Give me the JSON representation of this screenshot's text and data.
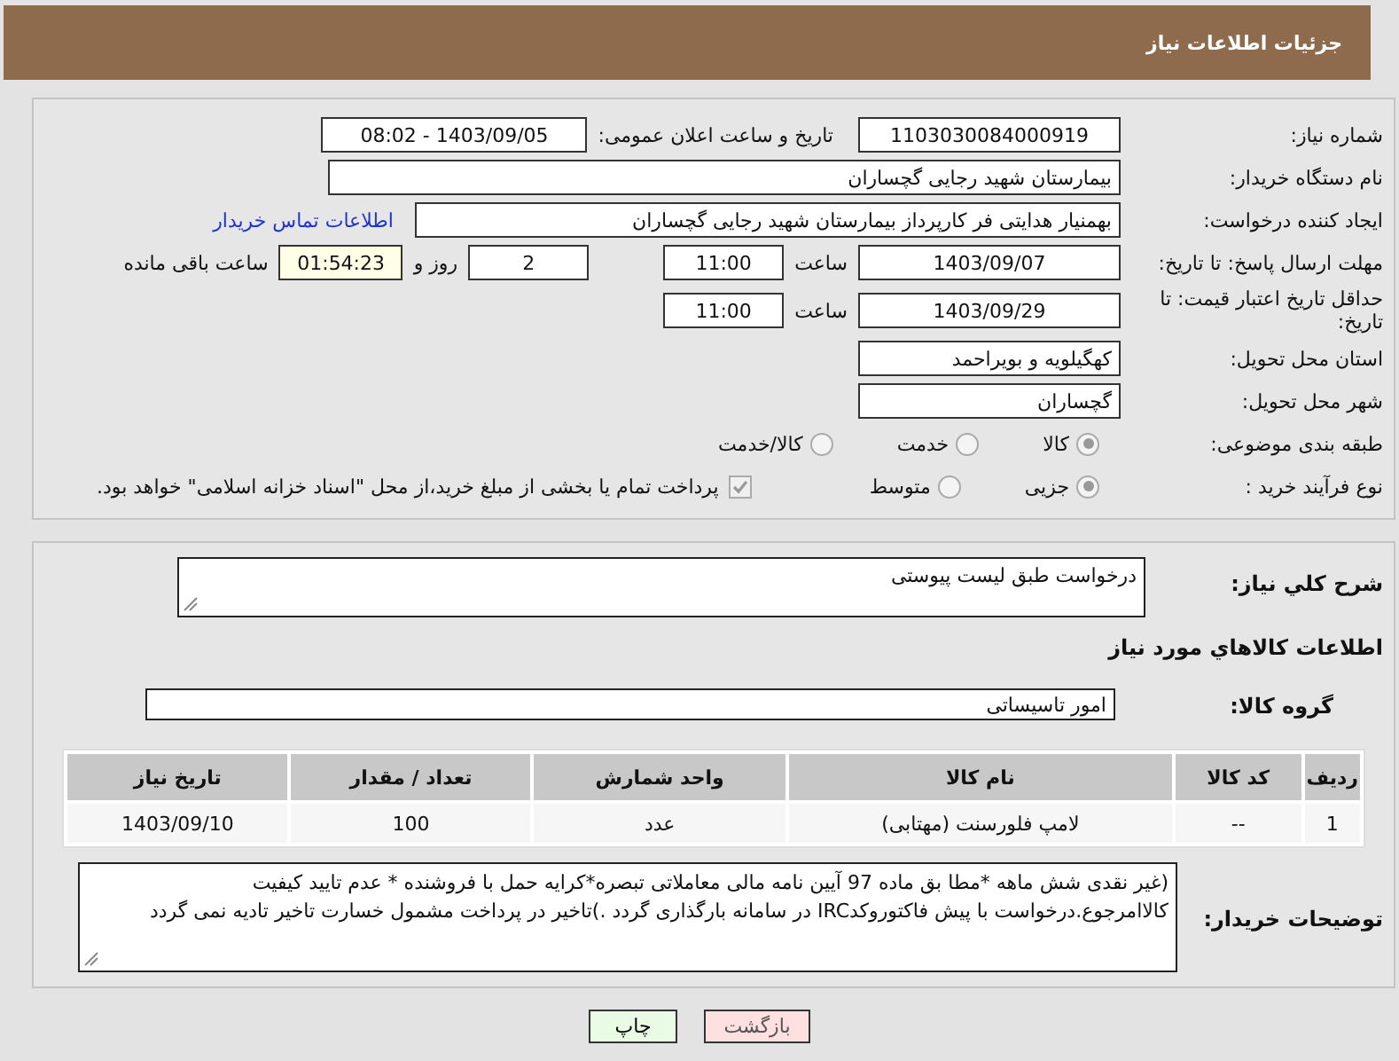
{
  "header": {
    "title": "جزئیات اطلاعات نیاز"
  },
  "need_number": {
    "label": "شماره نیاز:",
    "value": "1103030084000919"
  },
  "announce": {
    "label": "تاریخ و ساعت اعلان عمومی:",
    "value": "1403/09/05 - 08:02"
  },
  "buyer": {
    "label": "نام دستگاه خریدار:",
    "value": "بیمارستان شهید رجایی گچساران"
  },
  "creator": {
    "label": "ایجاد کننده درخواست:",
    "value": "بهمنیار هدایتی فر کارپرداز بیمارستان شهید رجایی گچساران",
    "link": "اطلاعات تماس خریدار"
  },
  "reply_deadline": {
    "label": "مهلت ارسال پاسخ: تا تاریخ:",
    "date": "1403/09/07",
    "time_label": "ساعت",
    "time": "11:00",
    "days": "2",
    "days_label": "روز و",
    "remaining": "01:54:23",
    "remaining_label": "ساعت باقی مانده"
  },
  "price_validity": {
    "label": "حداقل تاریخ اعتبار قیمت: تا تاریخ:",
    "date": "1403/09/29",
    "time_label": "ساعت",
    "time": "11:00"
  },
  "province": {
    "label": "استان محل تحویل:",
    "value": "کهگیلویه و بویراحمد"
  },
  "city": {
    "label": "شهر محل تحویل:",
    "value": "گچساران"
  },
  "category": {
    "label": "طبقه بندی موضوعی:",
    "options": [
      {
        "label": "کالا",
        "selected": true
      },
      {
        "label": "خدمت",
        "selected": false
      },
      {
        "label": "کالا/خدمت",
        "selected": false
      }
    ]
  },
  "purchase_type": {
    "label": "نوع فرآیند خرید :",
    "options": [
      {
        "label": "جزیی",
        "selected": true
      },
      {
        "label": "متوسط",
        "selected": false
      }
    ],
    "payment_note": {
      "checked": true,
      "text": "پرداخت تمام یا بخشی از مبلغ خرید،از محل \"اسناد خزانه اسلامی\" خواهد بود."
    }
  },
  "description": {
    "label": "شرح کلي نياز:",
    "value": "درخواست طبق لیست پیوستی"
  },
  "goods_title": "اطلاعات کالاهاي مورد نياز",
  "goods_group": {
    "label": "گروه کالا:",
    "value": "امور تاسیساتی"
  },
  "table": {
    "columns": [
      "رديف",
      "کد کالا",
      "نام کالا",
      "واحد شمارش",
      "تعداد / مقدار",
      "تاریخ نیاز"
    ],
    "rows": [
      [
        "1",
        "--",
        "لامپ فلورسنت (مهتابی)",
        "عدد",
        "100",
        "1403/09/10"
      ]
    ]
  },
  "buyer_notes": {
    "label": "توضیحات خریدار:",
    "value": "(غیر نقدی شش ماهه  *مطا بق ماده 97 آیین نامه مالی معاملاتی تبصره*کرایه حمل با فروشنده * عدم تایید کیفیت کالاامرجوع.درخواست با پیش فاکتوروکدIRC در سامانه بارگذاری گردد .)تاخیر در پرداخت مشمول خسارت تاخیر تادیه نمی گردد"
  },
  "buttons": [
    {
      "label": "بازگشت",
      "kind": "back"
    },
    {
      "label": "چاپ",
      "kind": "print"
    }
  ]
}
